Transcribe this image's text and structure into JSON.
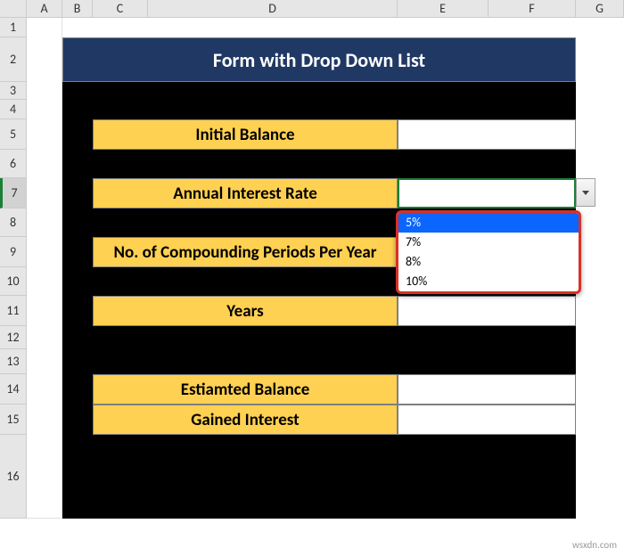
{
  "columns": [
    "A",
    "B",
    "C",
    "D",
    "E",
    "F",
    "G"
  ],
  "rows": [
    "1",
    "2",
    "3",
    "4",
    "5",
    "6",
    "7",
    "8",
    "9",
    "10",
    "11",
    "12",
    "13",
    "14",
    "15",
    "16"
  ],
  "title": "Form with Drop Down List",
  "labels": {
    "initial_balance": "Initial Balance",
    "annual_rate": "Annual Interest Rate",
    "compounding": "No. of Compounding Periods Per Year",
    "years": "Years",
    "estimated_balance": "Estiamted Balance",
    "gained_interest": "Gained Interest"
  },
  "dropdown": {
    "options": [
      "5%",
      "7%",
      "8%",
      "10%"
    ],
    "selected": "5%"
  },
  "watermark": "wsxdn.com"
}
